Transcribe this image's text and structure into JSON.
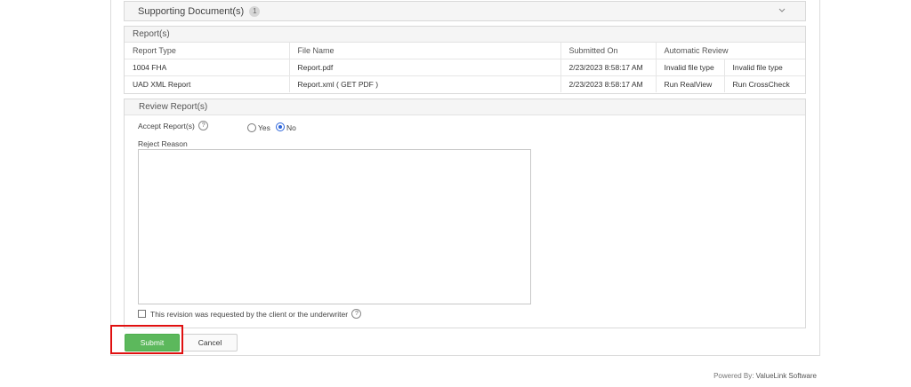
{
  "supporting": {
    "title": "Supporting Document(s)",
    "count": "1"
  },
  "reports": {
    "title": "Report(s)",
    "columns": [
      "Report Type",
      "File Name",
      "Submitted On",
      "Automatic Review"
    ],
    "rows": [
      {
        "type": "1004 FHA",
        "file": "Report.pdf",
        "submitted": "2/23/2023 8:58:17 AM",
        "review1": "Invalid file type",
        "review2": "Invalid file type"
      },
      {
        "type": "UAD XML Report",
        "file": "Report.xml  ( GET PDF )",
        "submitted": "2/23/2023 8:58:17 AM",
        "review1": "Run RealView",
        "review2": "Run CrossCheck"
      }
    ]
  },
  "review": {
    "title": "Review Report(s)",
    "accept_label": "Accept Report(s)",
    "help_glyph": "?",
    "yes_label": "Yes",
    "no_label": "No",
    "selected": "No",
    "reject_label": "Reject Reason",
    "reject_value": "",
    "revision_label": "This revision was requested by the client or the underwriter"
  },
  "actions": {
    "submit_label": "Submit",
    "cancel_label": "Cancel"
  },
  "footer": {
    "powered_prefix": "Powered By:",
    "powered_brand": "ValueLink Software"
  },
  "colors": {
    "submit": "#5cb85c",
    "link": "#2a6ebb",
    "highlight": "#e01010"
  }
}
